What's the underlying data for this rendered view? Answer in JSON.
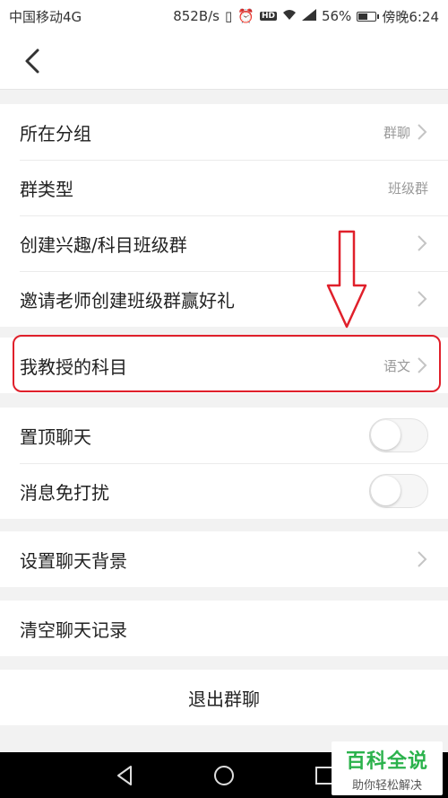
{
  "status_bar": {
    "carrier": "中国移动4G",
    "speed": "852B/s",
    "hd": "HD",
    "battery": "56%",
    "time": "傍晚6:24"
  },
  "nav": {
    "back_icon": "chevron-left-icon"
  },
  "group1": {
    "group_row": {
      "label": "所在分组",
      "value": "群聊"
    },
    "type_row": {
      "label": "群类型",
      "value": "班级群"
    },
    "create_row": {
      "label": "创建兴趣/科目班级群"
    },
    "invite_row": {
      "label": "邀请老师创建班级群赢好礼"
    }
  },
  "group2": {
    "subject_row": {
      "label": "我教授的科目",
      "value": "语文"
    }
  },
  "group3": {
    "pin_row": {
      "label": "置顶聊天",
      "on": false
    },
    "mute_row": {
      "label": "消息免打扰",
      "on": false
    }
  },
  "group4": {
    "background_row": {
      "label": "设置聊天背景"
    }
  },
  "group5": {
    "clear_row": {
      "label": "清空聊天记录"
    }
  },
  "group6": {
    "exit_row": {
      "label": "退出群聊"
    }
  },
  "annotation": {
    "color": "#e0202b"
  },
  "watermark": {
    "title": "百科全说",
    "subtitle": "助你轻松解决"
  }
}
